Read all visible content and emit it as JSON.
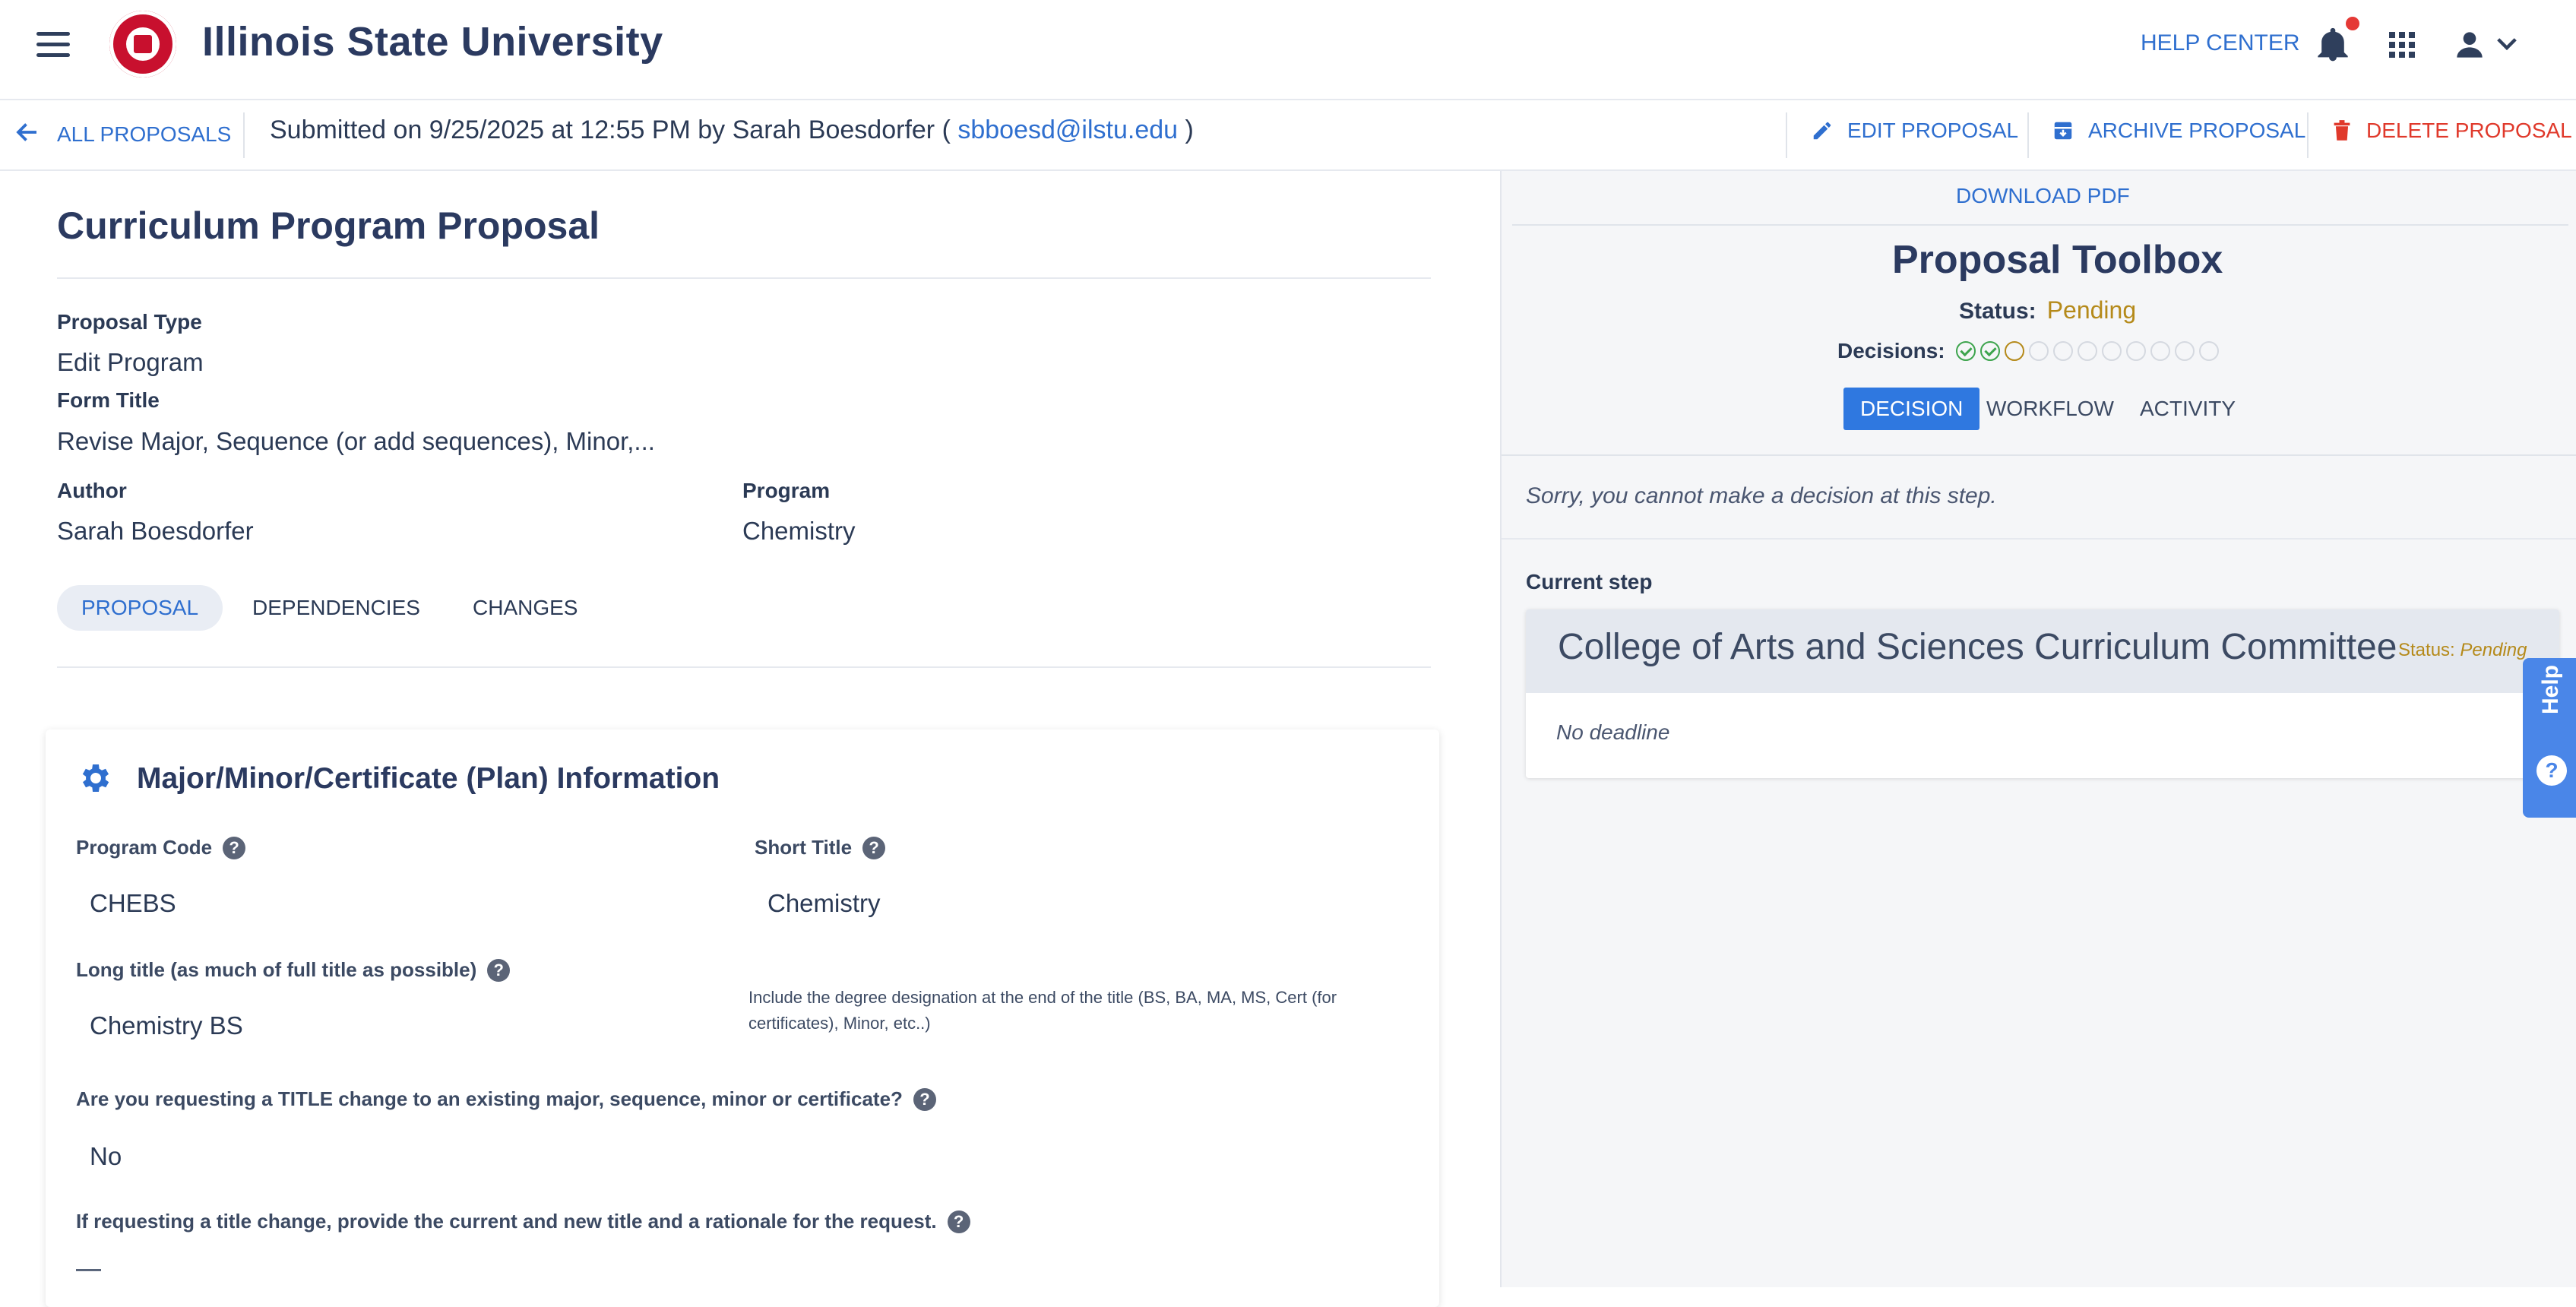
{
  "header": {
    "app_title": "Illinois State University",
    "help_center": "HELP CENTER"
  },
  "subbar": {
    "all_proposals": "ALL PROPOSALS",
    "submitted_prefix": "Submitted on 9/25/2025 at 12:55 PM by Sarah Boesdorfer (",
    "submitted_email": "sbboesd@ilstu.edu",
    "submitted_suffix": ")",
    "edit": "EDIT PROPOSAL",
    "archive": "ARCHIVE PROPOSAL",
    "delete": "DELETE PROPOSAL"
  },
  "proposal": {
    "title": "Curriculum Program Proposal",
    "type_label": "Proposal Type",
    "type_value": "Edit Program",
    "form_label": "Form Title",
    "form_value": "Revise Major, Sequence (or add sequences), Minor,...",
    "author_label": "Author",
    "author_value": "Sarah Boesdorfer",
    "program_label": "Program",
    "program_value": "Chemistry",
    "tabs": [
      "PROPOSAL",
      "DEPENDENCIES",
      "CHANGES"
    ]
  },
  "section": {
    "title": "Major/Minor/Certificate (Plan) Information",
    "program_code_label": "Program Code",
    "program_code_value": "CHEBS",
    "short_title_label": "Short Title",
    "short_title_value": "Chemistry",
    "long_title_label": "Long title (as much of full title as possible)",
    "long_title_value": "Chemistry BS",
    "long_title_hint": "Include the degree designation at the end of the title (BS, BA, MA, MS, Cert (for certificates), Minor, etc..)",
    "title_change_label": "Are you requesting a TITLE change to an existing major, sequence, minor or certificate?",
    "title_change_value": "No",
    "rationale_label": "If requesting a title change, provide the current and new title and a rationale for the request.",
    "rationale_value": "—"
  },
  "toolbox": {
    "download": "DOWNLOAD PDF",
    "title": "Proposal Toolbox",
    "status_label": "Status:",
    "status_value": "Pending",
    "decisions_label": "Decisions:",
    "decisions": {
      "approved": 2,
      "pending": 1,
      "remaining": 8
    },
    "tabs": [
      "DECISION",
      "WORKFLOW",
      "ACTIVITY"
    ],
    "sorry": "Sorry, you cannot make a decision at this step.",
    "current_step_label": "Current step",
    "step_name": "College of Arts and Sciences Curriculum Committee",
    "step_status_label": "Status:",
    "step_status_value": "Pending",
    "deadline": "No deadline"
  },
  "help_tab": {
    "label": "Help"
  },
  "colors": {
    "accent": "#2f78e0",
    "pending": "#b58a1a",
    "delete": "#e0392b",
    "approved": "#3da44d"
  }
}
